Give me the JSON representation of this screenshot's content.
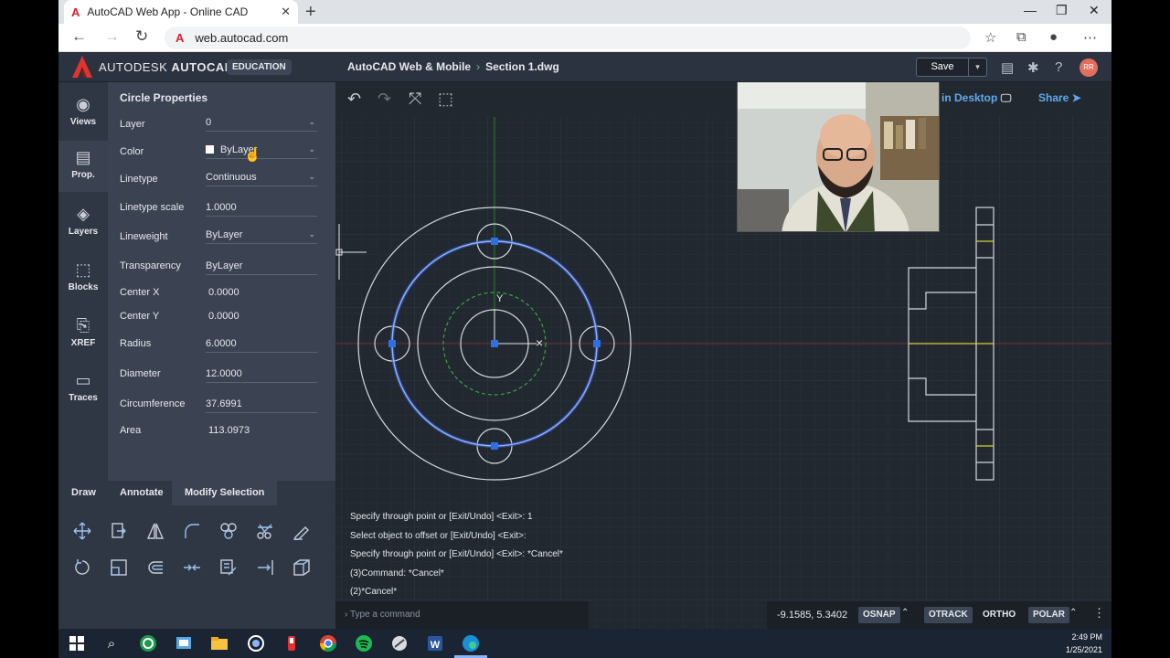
{
  "browser": {
    "tab_title": "AutoCAD Web App - Online CAD",
    "url": "web.autocad.com",
    "new_tab_glyph": "+",
    "icons": [
      "back-icon",
      "forward-icon",
      "reload-icon",
      "star-icon",
      "collections-icon",
      "profile-icon",
      "more-icon"
    ]
  },
  "app": {
    "brand_prefix": "AUTODESK",
    "brand_name": "AUTOCAD",
    "badge": "EDUCATION",
    "breadcrumb_root": "AutoCAD Web & Mobile",
    "breadcrumb_file": "Section 1.dwg",
    "save_label": "Save",
    "avatar_initials": "RR",
    "open_desktop_label": "in Desktop",
    "share_label": "Share",
    "accent": "#62a8ec"
  },
  "rail": [
    {
      "label": "Views",
      "icon": "eye-icon"
    },
    {
      "label": "Prop.",
      "icon": "properties-icon"
    },
    {
      "label": "Layers",
      "icon": "layers-icon"
    },
    {
      "label": "Blocks",
      "icon": "blocks-icon"
    },
    {
      "label": "XREF",
      "icon": "xref-icon"
    },
    {
      "label": "Traces",
      "icon": "traces-icon"
    }
  ],
  "properties": {
    "title": "Circle Properties",
    "rows": [
      {
        "label": "Layer",
        "value": "0",
        "dropdown": true
      },
      {
        "label": "Color",
        "value": "ByLayer",
        "dropdown": true
      },
      {
        "label": "Linetype",
        "value": "Continuous",
        "dropdown": true
      },
      {
        "label": "Linetype scale",
        "value": "1.0000"
      },
      {
        "label": "Lineweight",
        "value": "ByLayer",
        "dropdown": true
      },
      {
        "label": "Transparency",
        "value": "ByLayer"
      },
      {
        "label": "Center X",
        "value": "0.0000"
      },
      {
        "label": "Center Y",
        "value": "0.0000"
      },
      {
        "label": "Radius",
        "value": "6.0000"
      },
      {
        "label": "Diameter",
        "value": "12.0000"
      },
      {
        "label": "Circumference",
        "value": "37.6991"
      },
      {
        "label": "Area",
        "value": "113.0973"
      }
    ]
  },
  "tool_tabs": [
    "Draw",
    "Annotate",
    "Modify Selection"
  ],
  "tools": [
    "move-icon",
    "copy-icon",
    "mirror-icon",
    "fillet-icon",
    "array-icon",
    "trim-icon",
    "match-properties-icon",
    "rotate-icon",
    "scale-icon",
    "offset-icon",
    "join-icon",
    "edit-icon",
    "extend-icon",
    "3d-box-icon"
  ],
  "command_history": [
    "Specify through point or [Exit/Undo] <Exit>: 1",
    "Select object to offset or [Exit/Undo] <Exit>:",
    "Specify through point or [Exit/Undo] <Exit>: *Cancel*",
    "(3)Command: *Cancel*",
    "(2)*Cancel*"
  ],
  "command_placeholder": "Type a command",
  "status": {
    "coordinates": "-9.1585, 5.3402",
    "osnap": "OSNAP",
    "otrack": "OTRACK",
    "ortho": "ORTHO",
    "polar": "POLAR"
  },
  "taskbar": {
    "time": "2:49 PM",
    "date": "1/25/2021",
    "apps": [
      "windows-start-icon",
      "search-icon",
      "app-icon",
      "snip-icon",
      "file-explorer-icon",
      "circle-app-icon",
      "pen-app-icon",
      "chrome-icon",
      "spotify-icon",
      "app-icon",
      "word-icon",
      "edge-icon"
    ]
  },
  "colors": {
    "canvas": "#212830",
    "selected_circle": "#7b96f0",
    "dashed_circle": "#3fa33f",
    "grip": "#2f6fe6"
  }
}
